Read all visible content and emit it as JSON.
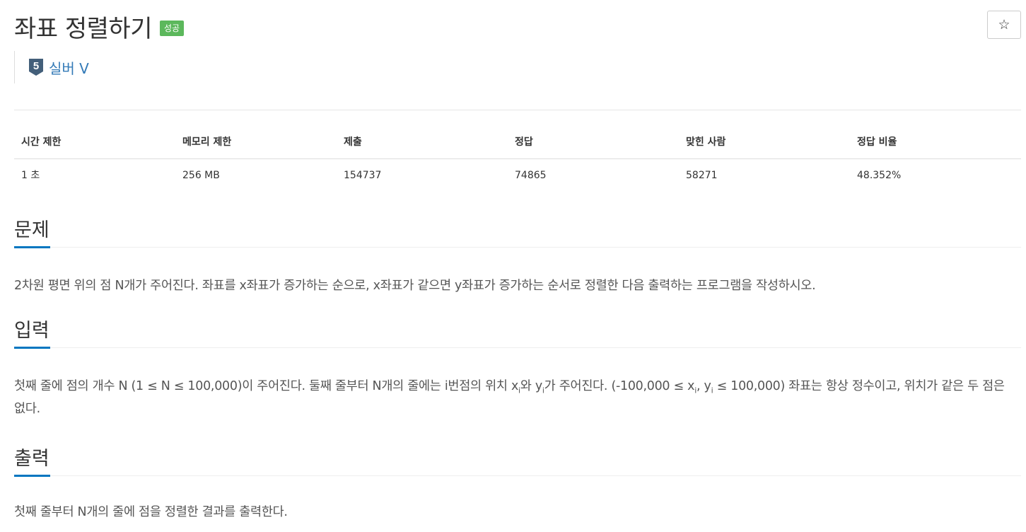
{
  "problem": {
    "title": "좌표 정렬하기",
    "status_badge": "성공",
    "star_glyph": "☆",
    "tier": {
      "icon": "silver-tier-5-icon",
      "level_number": "5",
      "label": "실버 V",
      "color": "#435f7a"
    }
  },
  "info_table": {
    "headers": [
      "시간 제한",
      "메모리 제한",
      "제출",
      "정답",
      "맞힌 사람",
      "정답 비율"
    ],
    "row": [
      "1 초",
      "256 MB",
      "154737",
      "74865",
      "58271",
      "48.352%"
    ]
  },
  "sections": {
    "problem_heading": "문제",
    "problem_text": "2차원 평면 위의 점 N개가 주어진다. 좌표를 x좌표가 증가하는 순으로, x좌표가 같으면 y좌표가 증가하는 순서로 정렬한 다음 출력하는 프로그램을 작성하시오.",
    "input_heading": "입력",
    "input_text": {
      "part1": "첫째 줄에 점의 개수 N (1 ≤ N ≤ 100,000)이 주어진다. 둘째 줄부터 N개의 줄에는 i번점의 위치 x",
      "sub1": "i",
      "part2": "와 y",
      "sub2": "i",
      "part3": "가 주어진다. (-100,000 ≤ x",
      "sub3": "i",
      "part4": ", y",
      "sub4": "i",
      "part5": " ≤ 100,000) 좌표는 항상 정수이고, 위치가 같은 두 점은 없다."
    },
    "output_heading": "출력",
    "output_text": "첫째 줄부터 N개의 줄에 점을 정렬한 결과를 출력한다."
  },
  "colors": {
    "badge_success": "#5cb85c",
    "heading_underline": "#0076c0",
    "tier_label": "#337ab7"
  }
}
